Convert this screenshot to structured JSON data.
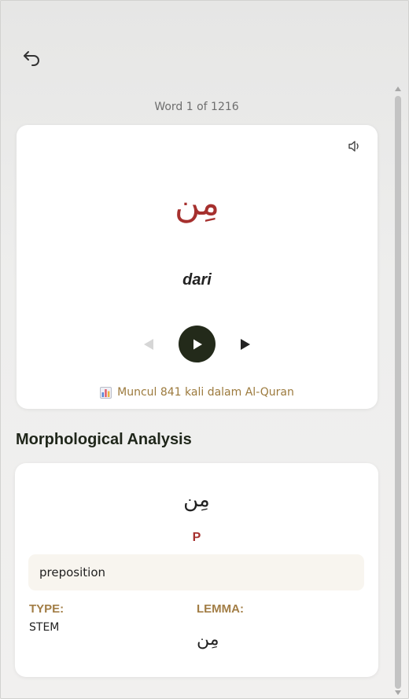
{
  "header": {
    "back_icon": "undo-arrow-icon",
    "counter": "Word 1 of 1216"
  },
  "word_card": {
    "arabic": "مِن",
    "translation": "dari",
    "speaker_icon": "speaker-icon",
    "frequency_icon": "bar-chart-icon",
    "frequency_text": "Muncul 841 kali dalam Al-Quran",
    "controls": {
      "prev_icon": "prev-triangle-icon",
      "play_icon": "play-icon",
      "next_icon": "next-triangle-icon"
    }
  },
  "morphology": {
    "title": "Morphological Analysis",
    "arabic": "مِن",
    "pos_tag": "P",
    "description": "preposition",
    "type_label": "TYPE:",
    "type_value": "STEM",
    "lemma_label": "LEMMA:",
    "lemma_value": "مِن"
  },
  "colors": {
    "arabic_accent": "#a6302e",
    "gold_label": "#a27d45",
    "play_button": "#232a1a",
    "frequency_text": "#9c7a3d"
  }
}
